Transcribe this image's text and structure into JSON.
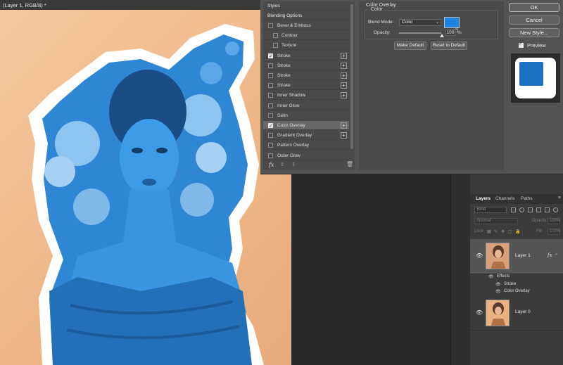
{
  "document": {
    "tab_title": "(Layer 1, RGB/8) *"
  },
  "dialog": {
    "styles_header": "Styles",
    "blending_options": "Blending Options",
    "styles": [
      {
        "label": "Bevel & Emboss",
        "checked": false,
        "plus": false,
        "sub": false
      },
      {
        "label": "Contour",
        "checked": false,
        "plus": false,
        "sub": true
      },
      {
        "label": "Texture",
        "checked": false,
        "plus": false,
        "sub": true
      },
      {
        "label": "Stroke",
        "checked": true,
        "plus": true,
        "sub": false
      },
      {
        "label": "Stroke",
        "checked": false,
        "plus": true,
        "sub": false
      },
      {
        "label": "Stroke",
        "checked": false,
        "plus": true,
        "sub": false
      },
      {
        "label": "Stroke",
        "checked": false,
        "plus": true,
        "sub": false
      },
      {
        "label": "Inner Shadow",
        "checked": false,
        "plus": true,
        "sub": false
      },
      {
        "label": "Inner Glow",
        "checked": false,
        "plus": false,
        "sub": false
      },
      {
        "label": "Satin",
        "checked": false,
        "plus": false,
        "sub": false
      },
      {
        "label": "Color Overlay",
        "checked": true,
        "plus": true,
        "sub": false,
        "active": true
      },
      {
        "label": "Gradient Overlay",
        "checked": false,
        "plus": true,
        "sub": false
      },
      {
        "label": "Pattern Overlay",
        "checked": false,
        "plus": false,
        "sub": false
      },
      {
        "label": "Outer Glow",
        "checked": false,
        "plus": false,
        "sub": false
      }
    ],
    "footer": {
      "fx": "fx",
      "up": "⇧",
      "down": "⇩",
      "trash": "🗑"
    },
    "overlay": {
      "title": "Color Overlay",
      "group": "Color",
      "blend_mode_label": "Blend Mode:",
      "blend_mode_value": "Color",
      "overlay_color": "#1e86dc",
      "opacity_label": "Opacity:",
      "opacity_value": "100",
      "opacity_unit": "%",
      "make_default": "Make Default",
      "reset_default": "Reset to Default"
    },
    "buttons": {
      "ok": "OK",
      "cancel": "Cancel",
      "new_style": "New Style..."
    },
    "preview_label": "Preview"
  },
  "layers": {
    "tabs": [
      "Layers",
      "Channels",
      "Paths"
    ],
    "filter_placeholder": "Kind",
    "blend_mode": "Normal",
    "opacity_label": "Opacity:",
    "opacity_value": "100%",
    "lock_label": "Lock:",
    "fill_label": "Fill:",
    "fill_value": "100%",
    "items": [
      {
        "name": "Layer 1",
        "fx": "fx",
        "selected": true
      },
      {
        "name": "Layer 0",
        "fx": "",
        "selected": false
      }
    ],
    "effects_label": "Effects",
    "effects": [
      "Stroke",
      "Color Overlay"
    ]
  }
}
